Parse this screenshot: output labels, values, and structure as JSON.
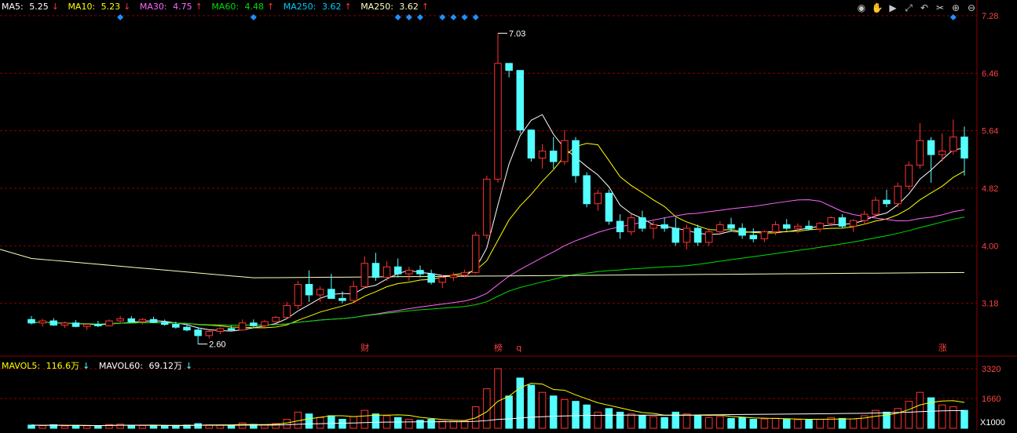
{
  "legend_price": [
    {
      "label": "MA5: ",
      "value": "5.25",
      "arrow": "↓",
      "color": "#ffffff"
    },
    {
      "label": "MA10: ",
      "value": "5.23",
      "arrow": "↓",
      "color": "#ffff00"
    },
    {
      "label": "MA30: ",
      "value": "4.75",
      "arrow": "↑",
      "color": "#ff66ff"
    },
    {
      "label": "MA60: ",
      "value": "4.48",
      "arrow": "↑",
      "color": "#00dd00"
    },
    {
      "label": "MA250: ",
      "value": "3.62",
      "arrow": "↑",
      "color": "#00ccff"
    },
    {
      "label": "MA250: ",
      "value": "3.62",
      "arrow": "↑",
      "color": "#ffffc0"
    }
  ],
  "legend_volume": [
    {
      "label": "MAVOL5: ",
      "value": "116.6万",
      "arrow": "↓",
      "color": "#ffff00"
    },
    {
      "label": "MAVOL60: ",
      "value": "69.12万",
      "arrow": "↓",
      "color": "#ffffff"
    }
  ],
  "toolbar_icons": [
    "eye-icon",
    "hand-icon",
    "play-icon",
    "restore-icon",
    "undo-icon",
    "scissors-icon",
    "plus-icon",
    "minus-icon"
  ],
  "colors": {
    "up": "#ff3232",
    "down": "#54ffff",
    "grid": "#8b0000",
    "axis_text": "#ff4040",
    "annotation": "#ffffff",
    "marker": "#1e90ff"
  },
  "chart_data": {
    "type": "candlestick",
    "price_axis": {
      "ticks": [
        "7.28",
        "6.46",
        "5.64",
        "4.82",
        "4.00",
        "3.18"
      ],
      "range": [
        2.45,
        7.28
      ]
    },
    "volume_axis": {
      "ticks": [
        "3320",
        "1660",
        "X1000"
      ],
      "range": [
        0,
        3320
      ]
    },
    "annotations": [
      {
        "text": "7.03",
        "type": "high"
      },
      {
        "text": "2.60",
        "type": "low"
      }
    ],
    "event_markers": [
      "财",
      "榜",
      "q",
      "涨"
    ],
    "bars": [
      {
        "o": 2.95,
        "h": 3.0,
        "l": 2.88,
        "c": 2.9,
        "v": 180
      },
      {
        "o": 2.9,
        "h": 2.96,
        "l": 2.85,
        "c": 2.93,
        "v": 150
      },
      {
        "o": 2.93,
        "h": 2.97,
        "l": 2.86,
        "c": 2.87,
        "v": 200
      },
      {
        "o": 2.87,
        "h": 2.92,
        "l": 2.83,
        "c": 2.9,
        "v": 130
      },
      {
        "o": 2.9,
        "h": 2.94,
        "l": 2.84,
        "c": 2.85,
        "v": 160
      },
      {
        "o": 2.85,
        "h": 2.9,
        "l": 2.8,
        "c": 2.88,
        "v": 140
      },
      {
        "o": 2.88,
        "h": 2.93,
        "l": 2.84,
        "c": 2.86,
        "v": 120
      },
      {
        "o": 2.86,
        "h": 2.95,
        "l": 2.85,
        "c": 2.93,
        "v": 210
      },
      {
        "o": 2.93,
        "h": 3.0,
        "l": 2.9,
        "c": 2.96,
        "v": 230
      },
      {
        "o": 2.96,
        "h": 3.0,
        "l": 2.91,
        "c": 2.92,
        "v": 170
      },
      {
        "o": 2.92,
        "h": 2.97,
        "l": 2.88,
        "c": 2.95,
        "v": 150
      },
      {
        "o": 2.95,
        "h": 2.99,
        "l": 2.9,
        "c": 2.91,
        "v": 130
      },
      {
        "o": 2.91,
        "h": 2.95,
        "l": 2.86,
        "c": 2.88,
        "v": 140
      },
      {
        "o": 2.88,
        "h": 2.92,
        "l": 2.82,
        "c": 2.84,
        "v": 160
      },
      {
        "o": 2.84,
        "h": 2.88,
        "l": 2.78,
        "c": 2.8,
        "v": 180
      },
      {
        "o": 2.8,
        "h": 2.84,
        "l": 2.6,
        "c": 2.72,
        "v": 260
      },
      {
        "o": 2.72,
        "h": 2.8,
        "l": 2.68,
        "c": 2.78,
        "v": 190
      },
      {
        "o": 2.78,
        "h": 2.84,
        "l": 2.74,
        "c": 2.82,
        "v": 170
      },
      {
        "o": 2.82,
        "h": 2.86,
        "l": 2.78,
        "c": 2.8,
        "v": 150
      },
      {
        "o": 2.8,
        "h": 2.95,
        "l": 2.79,
        "c": 2.9,
        "v": 300
      },
      {
        "o": 2.9,
        "h": 2.95,
        "l": 2.84,
        "c": 2.86,
        "v": 220
      },
      {
        "o": 2.86,
        "h": 2.94,
        "l": 2.84,
        "c": 2.92,
        "v": 200
      },
      {
        "o": 2.92,
        "h": 3.0,
        "l": 2.9,
        "c": 2.98,
        "v": 260
      },
      {
        "o": 2.98,
        "h": 3.2,
        "l": 2.96,
        "c": 3.15,
        "v": 500
      },
      {
        "o": 3.15,
        "h": 3.5,
        "l": 3.1,
        "c": 3.45,
        "v": 900
      },
      {
        "o": 3.45,
        "h": 3.65,
        "l": 3.2,
        "c": 3.3,
        "v": 800
      },
      {
        "o": 3.3,
        "h": 3.42,
        "l": 3.2,
        "c": 3.38,
        "v": 600
      },
      {
        "o": 3.38,
        "h": 3.6,
        "l": 3.3,
        "c": 3.25,
        "v": 700
      },
      {
        "o": 3.25,
        "h": 3.35,
        "l": 3.18,
        "c": 3.22,
        "v": 500
      },
      {
        "o": 3.22,
        "h": 3.5,
        "l": 3.2,
        "c": 3.42,
        "v": 650
      },
      {
        "o": 3.42,
        "h": 3.85,
        "l": 3.4,
        "c": 3.75,
        "v": 1000
      },
      {
        "o": 3.75,
        "h": 3.9,
        "l": 3.5,
        "c": 3.55,
        "v": 800
      },
      {
        "o": 3.55,
        "h": 3.78,
        "l": 3.5,
        "c": 3.7,
        "v": 700
      },
      {
        "o": 3.7,
        "h": 3.82,
        "l": 3.55,
        "c": 3.6,
        "v": 600
      },
      {
        "o": 3.6,
        "h": 3.7,
        "l": 3.5,
        "c": 3.65,
        "v": 500
      },
      {
        "o": 3.65,
        "h": 3.72,
        "l": 3.55,
        "c": 3.6,
        "v": 450
      },
      {
        "o": 3.6,
        "h": 3.66,
        "l": 3.45,
        "c": 3.48,
        "v": 500
      },
      {
        "o": 3.48,
        "h": 3.58,
        "l": 3.4,
        "c": 3.55,
        "v": 400
      },
      {
        "o": 3.55,
        "h": 3.62,
        "l": 3.5,
        "c": 3.58,
        "v": 380
      },
      {
        "o": 3.58,
        "h": 3.66,
        "l": 3.55,
        "c": 3.62,
        "v": 420
      },
      {
        "o": 3.62,
        "h": 4.2,
        "l": 3.6,
        "c": 4.15,
        "v": 1200
      },
      {
        "o": 4.15,
        "h": 5.0,
        "l": 4.1,
        "c": 4.95,
        "v": 2200
      },
      {
        "o": 4.95,
        "h": 7.03,
        "l": 4.9,
        "c": 6.6,
        "v": 3320
      },
      {
        "o": 6.6,
        "h": 6.6,
        "l": 6.4,
        "c": 6.5,
        "v": 1800
      },
      {
        "o": 6.5,
        "h": 6.5,
        "l": 5.6,
        "c": 5.65,
        "v": 2800
      },
      {
        "o": 5.65,
        "h": 5.66,
        "l": 5.2,
        "c": 5.25,
        "v": 2400
      },
      {
        "o": 5.25,
        "h": 5.45,
        "l": 5.1,
        "c": 5.35,
        "v": 2000
      },
      {
        "o": 5.35,
        "h": 5.55,
        "l": 5.1,
        "c": 5.2,
        "v": 1800
      },
      {
        "o": 5.2,
        "h": 5.65,
        "l": 5.15,
        "c": 5.5,
        "v": 1600
      },
      {
        "o": 5.5,
        "h": 5.55,
        "l": 4.9,
        "c": 5.0,
        "v": 1500
      },
      {
        "o": 5.0,
        "h": 5.05,
        "l": 4.55,
        "c": 4.6,
        "v": 1300
      },
      {
        "o": 4.6,
        "h": 4.8,
        "l": 4.5,
        "c": 4.75,
        "v": 900
      },
      {
        "o": 4.75,
        "h": 4.8,
        "l": 4.3,
        "c": 4.35,
        "v": 1100
      },
      {
        "o": 4.35,
        "h": 4.45,
        "l": 4.1,
        "c": 4.2,
        "v": 900
      },
      {
        "o": 4.2,
        "h": 4.45,
        "l": 4.15,
        "c": 4.4,
        "v": 800
      },
      {
        "o": 4.4,
        "h": 4.5,
        "l": 4.2,
        "c": 4.25,
        "v": 700
      },
      {
        "o": 4.25,
        "h": 4.35,
        "l": 4.1,
        "c": 4.3,
        "v": 650
      },
      {
        "o": 4.3,
        "h": 4.4,
        "l": 4.2,
        "c": 4.25,
        "v": 600
      },
      {
        "o": 4.25,
        "h": 4.4,
        "l": 4.0,
        "c": 4.05,
        "v": 900
      },
      {
        "o": 4.05,
        "h": 4.3,
        "l": 3.95,
        "c": 4.25,
        "v": 800
      },
      {
        "o": 4.25,
        "h": 4.3,
        "l": 4.0,
        "c": 4.05,
        "v": 700
      },
      {
        "o": 4.05,
        "h": 4.25,
        "l": 4.0,
        "c": 4.2,
        "v": 600
      },
      {
        "o": 4.2,
        "h": 4.35,
        "l": 4.15,
        "c": 4.3,
        "v": 650
      },
      {
        "o": 4.3,
        "h": 4.4,
        "l": 4.2,
        "c": 4.25,
        "v": 550
      },
      {
        "o": 4.25,
        "h": 4.32,
        "l": 4.1,
        "c": 4.15,
        "v": 600
      },
      {
        "o": 4.15,
        "h": 4.25,
        "l": 4.05,
        "c": 4.1,
        "v": 500
      },
      {
        "o": 4.1,
        "h": 4.22,
        "l": 4.05,
        "c": 4.2,
        "v": 520
      },
      {
        "o": 4.2,
        "h": 4.35,
        "l": 4.15,
        "c": 4.3,
        "v": 560
      },
      {
        "o": 4.3,
        "h": 4.38,
        "l": 4.22,
        "c": 4.25,
        "v": 500
      },
      {
        "o": 4.25,
        "h": 4.32,
        "l": 4.18,
        "c": 4.28,
        "v": 480
      },
      {
        "o": 4.28,
        "h": 4.36,
        "l": 4.22,
        "c": 4.24,
        "v": 460
      },
      {
        "o": 4.24,
        "h": 4.34,
        "l": 4.2,
        "c": 4.32,
        "v": 500
      },
      {
        "o": 4.32,
        "h": 4.42,
        "l": 4.28,
        "c": 4.4,
        "v": 600
      },
      {
        "o": 4.4,
        "h": 4.45,
        "l": 4.25,
        "c": 4.28,
        "v": 550
      },
      {
        "o": 4.28,
        "h": 4.38,
        "l": 4.2,
        "c": 4.36,
        "v": 520
      },
      {
        "o": 4.36,
        "h": 4.5,
        "l": 4.3,
        "c": 4.45,
        "v": 700
      },
      {
        "o": 4.45,
        "h": 4.7,
        "l": 4.4,
        "c": 4.65,
        "v": 1000
      },
      {
        "o": 4.65,
        "h": 4.8,
        "l": 4.55,
        "c": 4.6,
        "v": 900
      },
      {
        "o": 4.6,
        "h": 4.9,
        "l": 4.55,
        "c": 4.85,
        "v": 1100
      },
      {
        "o": 4.85,
        "h": 5.2,
        "l": 4.8,
        "c": 5.15,
        "v": 1500
      },
      {
        "o": 5.15,
        "h": 5.75,
        "l": 5.1,
        "c": 5.5,
        "v": 2000
      },
      {
        "o": 5.5,
        "h": 5.55,
        "l": 4.9,
        "c": 5.3,
        "v": 1700
      },
      {
        "o": 5.3,
        "h": 5.6,
        "l": 5.2,
        "c": 5.35,
        "v": 1300
      },
      {
        "o": 5.35,
        "h": 5.8,
        "l": 5.3,
        "c": 5.55,
        "v": 1200
      },
      {
        "o": 5.55,
        "h": 5.7,
        "l": 5.0,
        "c": 5.25,
        "v": 1000
      }
    ]
  }
}
